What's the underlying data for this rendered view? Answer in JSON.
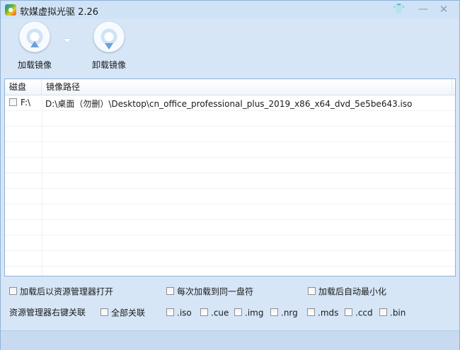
{
  "window": {
    "title": "软媒虚拟光驱 2.26",
    "controls": {
      "skin": "👕",
      "minimize": "—",
      "close": "✕"
    }
  },
  "toolbar": {
    "load_label": "加载镜像",
    "unload_label": "卸载镜像"
  },
  "list": {
    "columns": [
      "磁盘",
      "镜像路径"
    ],
    "rows": [
      {
        "drive": "F:\\",
        "path": "D:\\桌面（勿删）\\Desktop\\cn_office_professional_plus_2019_x86_x64_dvd_5e5be643.iso",
        "checked": false
      }
    ]
  },
  "options": {
    "open_explorer_after_load": "加载后以资源管理器打开",
    "same_drive_each_time": "每次加载到同一盘符",
    "minimize_after_load": "加载后自动最小化",
    "context_menu_label": "资源管理器右键关联",
    "associate_all": "全部关联",
    "extensions": [
      ".iso",
      ".cue",
      ".img",
      ".nrg",
      ".mds",
      ".ccd",
      ".bin"
    ]
  },
  "colors": {
    "window_bg": "#d6e6f7",
    "accent": "#6ba0d8"
  }
}
